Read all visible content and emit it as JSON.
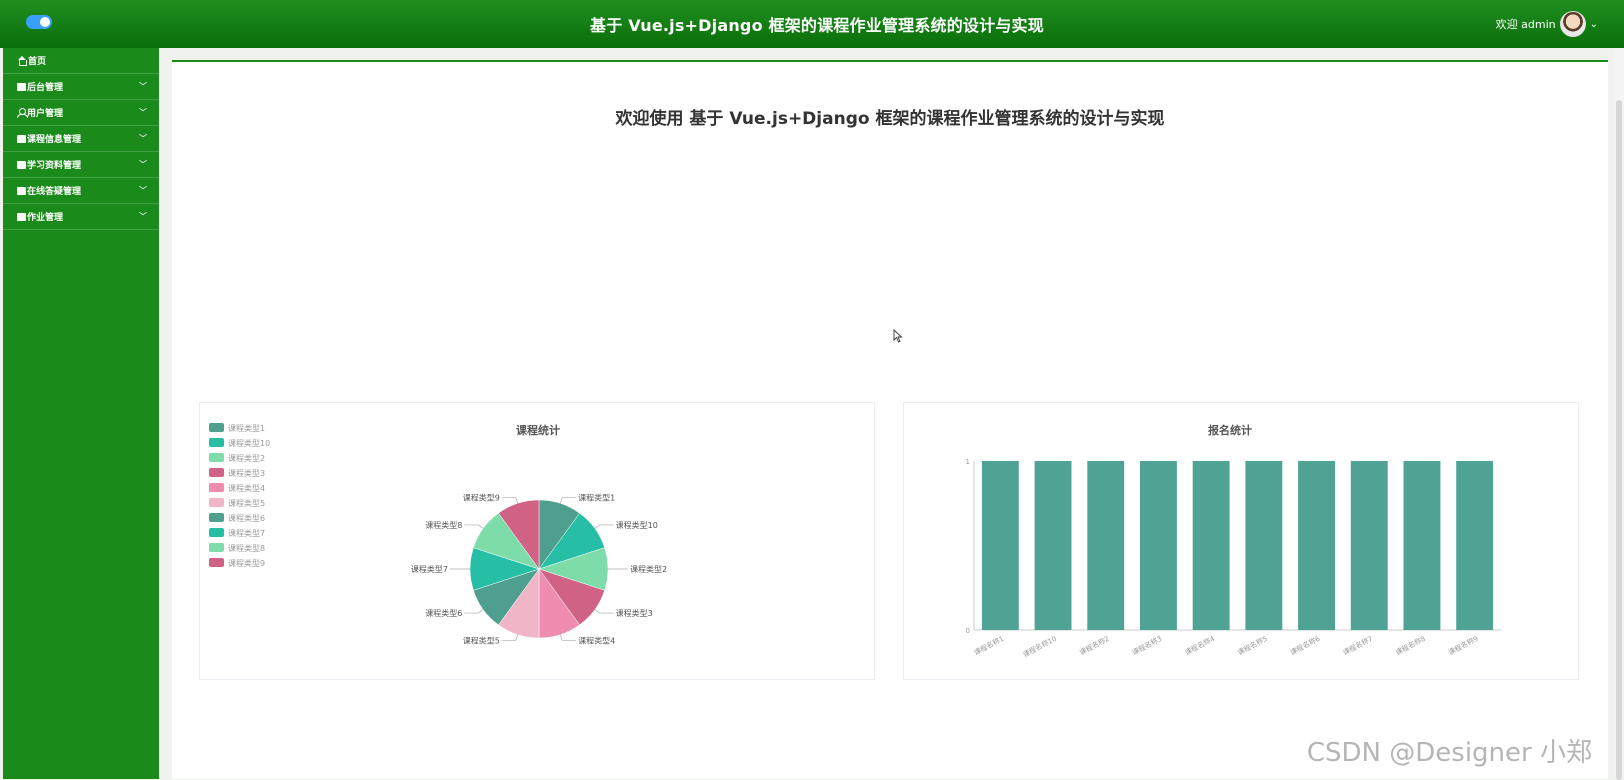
{
  "header": {
    "title": "基于 Vue.js+Django 框架的课程作业管理系统的设计与实现",
    "welcome_user": "欢迎 admin"
  },
  "sidebar": {
    "items": [
      {
        "label": "首页",
        "icon": "home-icon"
      },
      {
        "label": "后台管理",
        "icon": "panel-icon"
      },
      {
        "label": "用户管理",
        "icon": "user-icon"
      },
      {
        "label": "课程信息管理",
        "icon": "panel-icon"
      },
      {
        "label": "学习资料管理",
        "icon": "folder-icon"
      },
      {
        "label": "在线答疑管理",
        "icon": "panel-icon"
      },
      {
        "label": "作业管理",
        "icon": "save-icon"
      }
    ]
  },
  "main": {
    "welcome_text": "欢迎使用 基于 Vue.js+Django 框架的课程作业管理系统的设计与实现"
  },
  "chart_data": [
    {
      "type": "pie",
      "title": "课程统计",
      "legend_position": "top-left",
      "categories": [
        "课程类型1",
        "课程类型10",
        "课程类型2",
        "课程类型3",
        "课程类型4",
        "课程类型5",
        "课程类型6",
        "课程类型7",
        "课程类型8",
        "课程类型9"
      ],
      "values": [
        1,
        1,
        1,
        1,
        1,
        1,
        1,
        1,
        1,
        1
      ],
      "colors": [
        "#4f9f8f",
        "#26bfa5",
        "#7ddcaa",
        "#d06385",
        "#f08cb0",
        "#f0b6c8",
        "#4f9f8f",
        "#26bfa5",
        "#7ddcaa",
        "#d06385"
      ]
    },
    {
      "type": "bar",
      "title": "报名统计",
      "categories": [
        "课程名称1",
        "课程名称10",
        "课程名称2",
        "课程名称3",
        "课程名称4",
        "课程名称5",
        "课程名称6",
        "课程名称7",
        "课程名称8",
        "课程名称9"
      ],
      "values": [
        1,
        1,
        1,
        1,
        1,
        1,
        1,
        1,
        1,
        1
      ],
      "ylim": [
        0,
        1
      ],
      "yticks": [
        "0",
        "1"
      ],
      "color": "#4fa394"
    }
  ],
  "watermark": "CSDN @Designer 小郑"
}
